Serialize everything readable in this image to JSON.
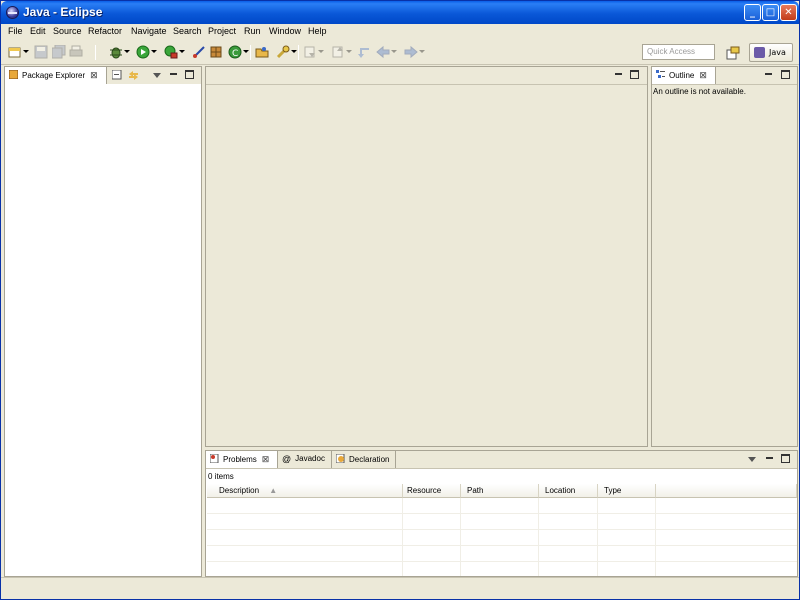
{
  "window": {
    "title": "Java - Eclipse"
  },
  "menubar": [
    "File",
    "Edit",
    "Source",
    "Refactor",
    "Navigate",
    "Search",
    "Project",
    "Run",
    "Window",
    "Help"
  ],
  "toolbar": {
    "quick_access_placeholder": "Quick Access",
    "perspective_label": "Java"
  },
  "package_explorer": {
    "tab_label": "Package Explorer"
  },
  "outline": {
    "tab_label": "Outline",
    "message": "An outline is not available."
  },
  "bottom_panel": {
    "tabs": [
      "Problems",
      "Javadoc",
      "Declaration"
    ],
    "items_count": "0 items",
    "columns": [
      "Description",
      "Resource",
      "Path",
      "Location",
      "Type"
    ]
  },
  "colors": {
    "titlebar_blue": "#0a58d8",
    "workbench_bg": "#ece9d8"
  },
  "icons": [
    "java-window-icon",
    "new-icon",
    "save-icon",
    "save-all-icon",
    "print-icon",
    "debug-icon",
    "run-icon",
    "coverage-icon",
    "external-tools-icon",
    "new-java-project-icon",
    "new-package-icon",
    "new-class-icon",
    "open-type-icon",
    "search-icon",
    "next-annotation-icon",
    "previous-annotation-icon",
    "last-edit-icon",
    "back-icon",
    "forward-icon"
  ]
}
